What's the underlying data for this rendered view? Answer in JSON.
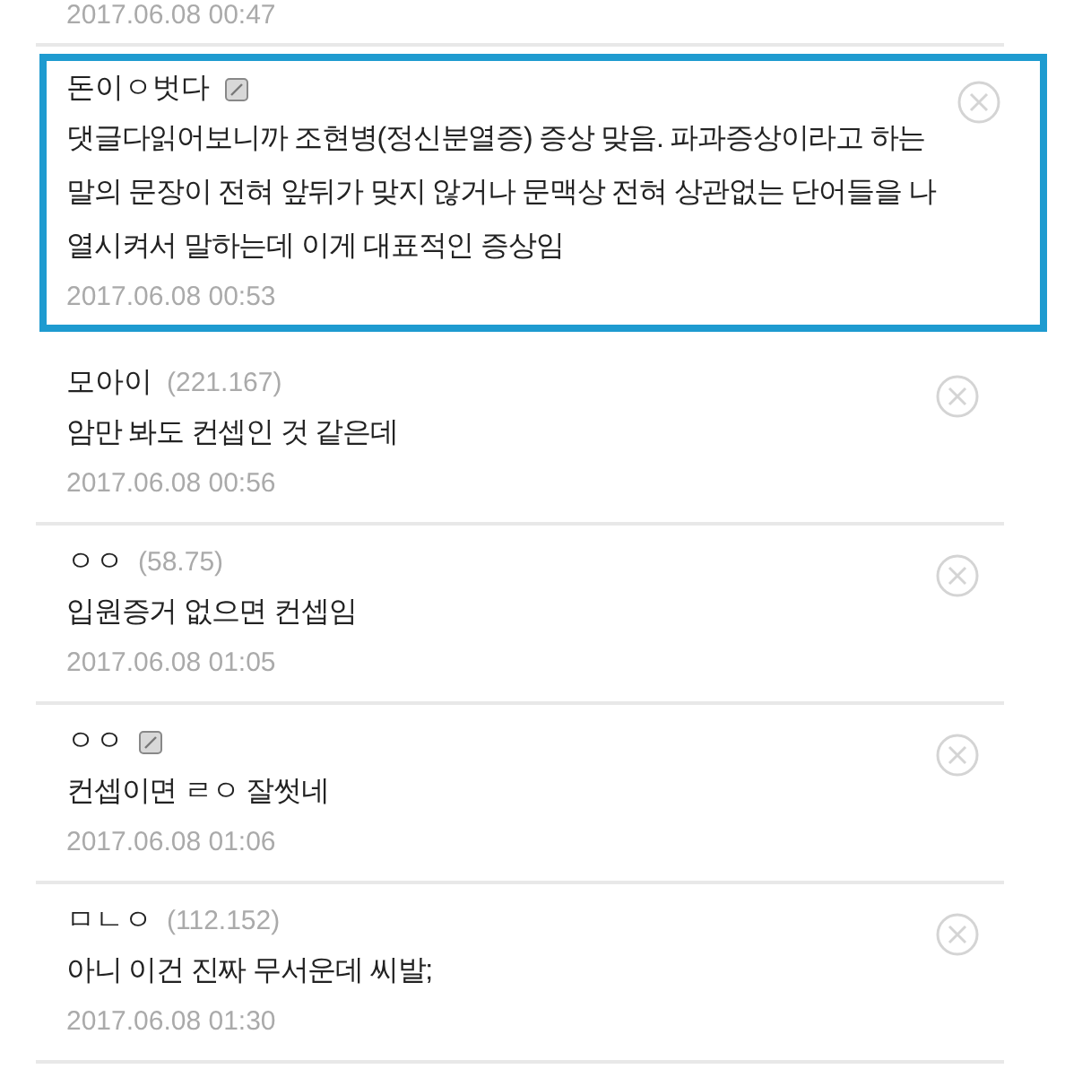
{
  "previous_date": "2017.06.08 00:47",
  "comments": [
    {
      "name": "돈이ㅇ벗다",
      "member_badge": true,
      "highlighted": true,
      "text": "댓글다읽어보니까 조현병(정신분열증) 증상 맞음. 파과증상이라고 하는 말의 문장이 전혀 앞뒤가 맞지 않거나 문맥상 전혀 상관없는 단어들을 나열시켜서 말하는데 이게 대표적인 증상임",
      "date": "2017.06.08 00:53"
    },
    {
      "name": "모아이",
      "ip": "(221.167)",
      "member_badge": false,
      "highlighted": false,
      "text": "암만 봐도 컨셉인 것 같은데",
      "date": "2017.06.08 00:56"
    },
    {
      "name": "ㅇㅇ",
      "ip": "(58.75)",
      "member_badge": false,
      "highlighted": false,
      "text": "입원증거 없으면 컨셉임",
      "date": "2017.06.08 01:05"
    },
    {
      "name": "ㅇㅇ",
      "member_badge": true,
      "highlighted": false,
      "text": "컨셉이면 ㄹㅇ 잘썻네",
      "date": "2017.06.08 01:06"
    },
    {
      "name": "ㅁㄴㅇ",
      "ip": "(112.152)",
      "member_badge": false,
      "highlighted": false,
      "text": "아니 이건 진짜 무서운데 씨발;",
      "date": "2017.06.08 01:30"
    }
  ]
}
